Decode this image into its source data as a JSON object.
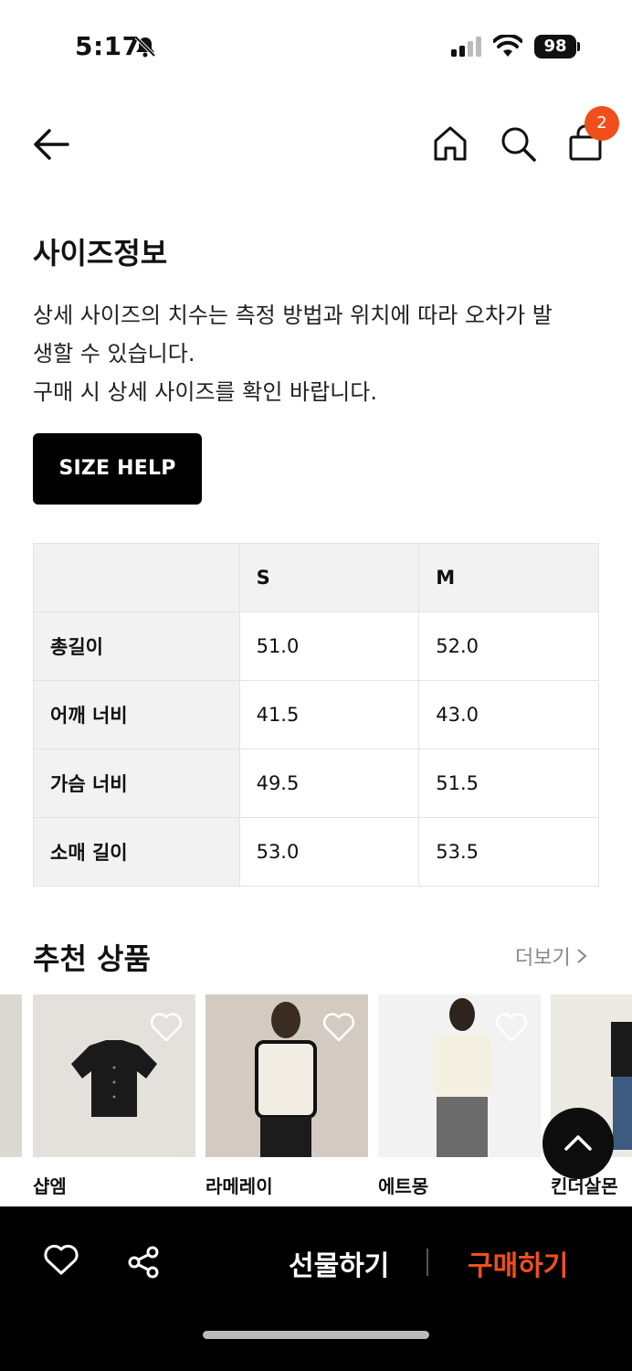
{
  "status_bar": {
    "time": "5:17",
    "battery": "98"
  },
  "header": {
    "cart_count": "2"
  },
  "size_info": {
    "title": "사이즈정보",
    "description_lines": [
      "상세 사이즈의 치수는 측정 방법과 위치에 따라 오차가 발",
      "생할 수 있습니다.",
      "구매 시 상세 사이즈를 확인 바랍니다."
    ],
    "help_button": "SIZE HELP",
    "table": {
      "columns": [
        "",
        "S",
        "M"
      ],
      "rows": [
        {
          "label": "총길이",
          "values": [
            "51.0",
            "52.0"
          ]
        },
        {
          "label": "어깨 너비",
          "values": [
            "41.5",
            "43.0"
          ]
        },
        {
          "label": "가슴 너비",
          "values": [
            "49.5",
            "51.5"
          ]
        },
        {
          "label": "소매 길이",
          "values": [
            "53.0",
            "53.5"
          ]
        }
      ]
    }
  },
  "recommendations": {
    "title": "추천 상품",
    "more": "더보기",
    "items": [
      {
        "brand": "샵엠"
      },
      {
        "brand": "라메레이"
      },
      {
        "brand": "에트몽"
      },
      {
        "brand": "킨더살몬"
      }
    ]
  },
  "bottom_bar": {
    "gift_label": "선물하기",
    "buy_label": "구매하기"
  },
  "colors": {
    "accent": "#f04f1b",
    "button_bg": "#000000",
    "table_header_bg": "#f2f2f2"
  },
  "icons": [
    "back-arrow-icon",
    "home-icon",
    "search-icon",
    "shopping-bag-icon",
    "heart-icon",
    "share-icon",
    "chevron-up-icon",
    "chevron-right-icon"
  ]
}
